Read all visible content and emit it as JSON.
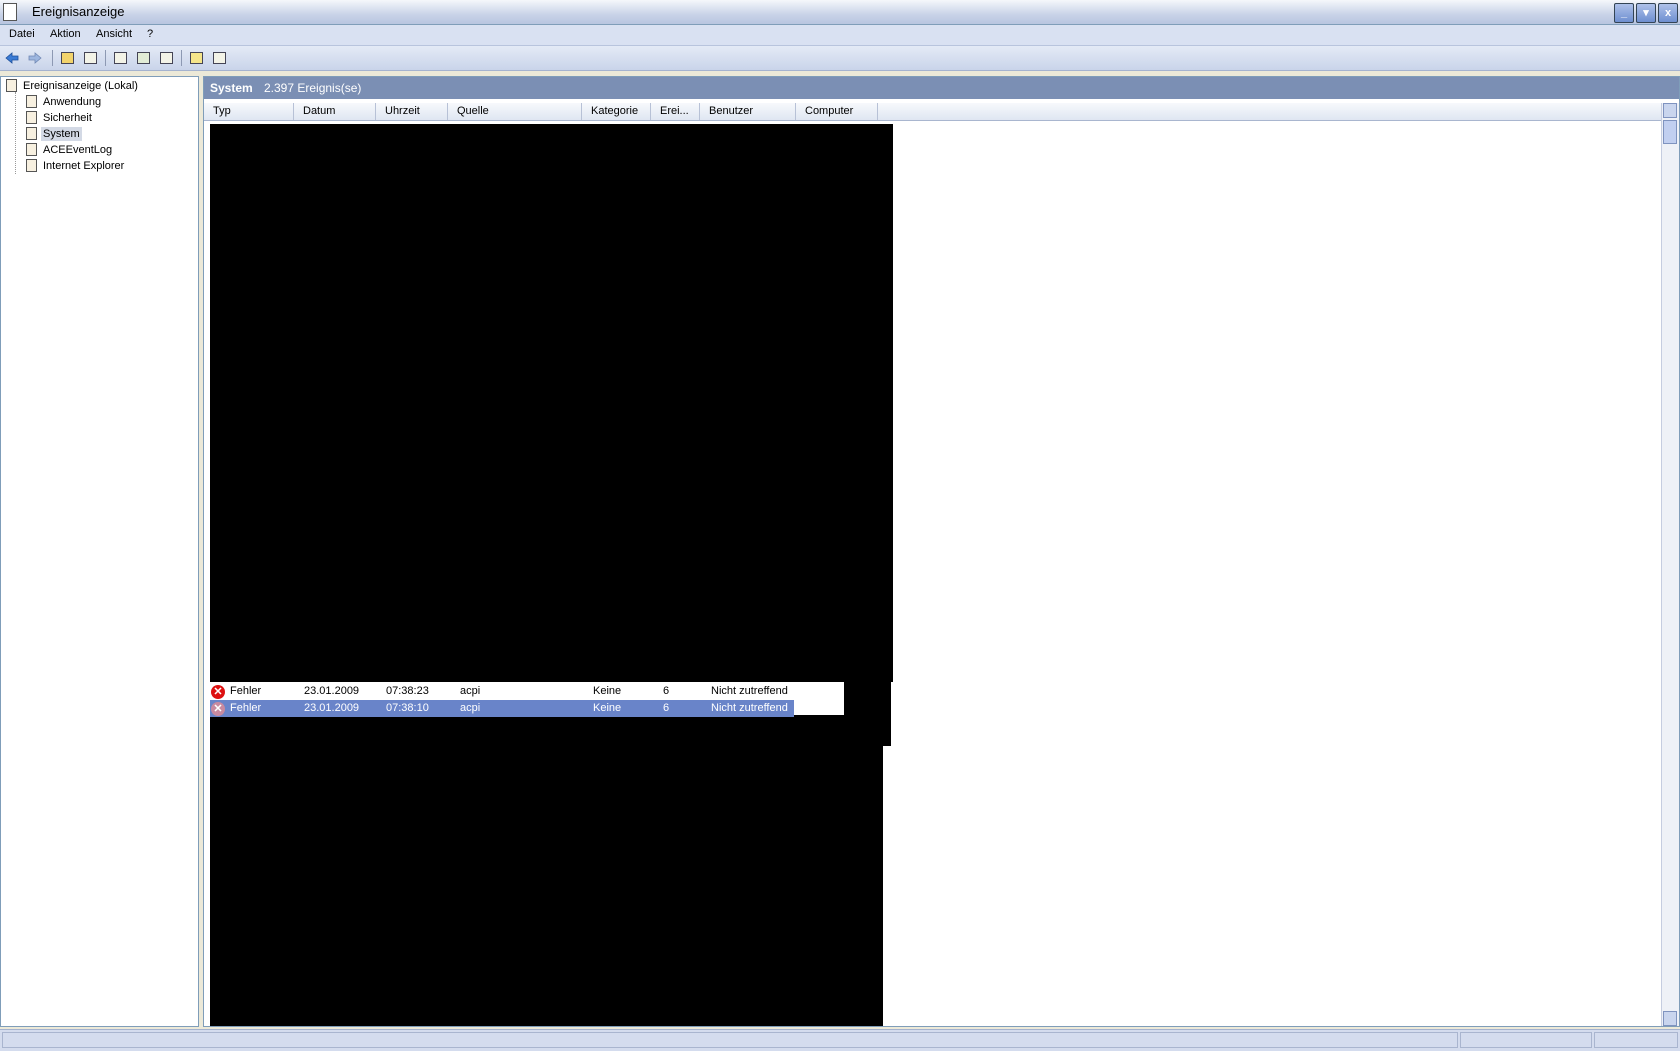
{
  "window": {
    "title": "Ereignisanzeige",
    "buttons": [
      "_",
      "▾",
      "x"
    ]
  },
  "menu": [
    "Datei",
    "Aktion",
    "Ansicht",
    "?"
  ],
  "tree": {
    "root": "Ereignisanzeige (Lokal)",
    "items": [
      "Anwendung",
      "Sicherheit",
      "System",
      "ACEEventLog",
      "Internet Explorer"
    ],
    "selected": "System"
  },
  "pane": {
    "title": "System",
    "count": "2.397 Ereignis(se)"
  },
  "columns": [
    "Typ",
    "Datum",
    "Uhrzeit",
    "Quelle",
    "Kategorie",
    "Erei...",
    "Benutzer",
    "Computer"
  ],
  "events": [
    {
      "type": "Fehler",
      "date": "23.01.2009",
      "time": "07:38:23",
      "source": "acpi",
      "category": "Keine",
      "event": "6",
      "user": "Nicht zutreffend",
      "selected": false
    },
    {
      "type": "Fehler",
      "date": "23.01.2009",
      "time": "07:38:10",
      "source": "acpi",
      "category": "Keine",
      "event": "6",
      "user": "Nicht zutreffend",
      "selected": true
    }
  ]
}
